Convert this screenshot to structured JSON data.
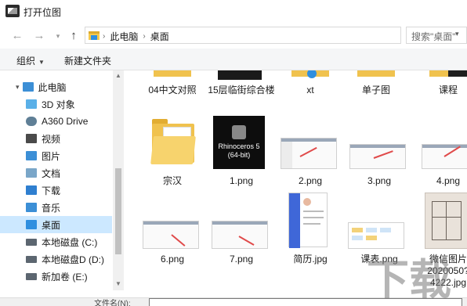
{
  "window": {
    "title": "打开位图"
  },
  "address": {
    "crumbs": [
      "此电脑",
      "桌面"
    ],
    "search_placeholder": "搜索\"桌面\""
  },
  "toolbar": {
    "organize": "组织",
    "new_folder": "新建文件夹"
  },
  "sidebar": {
    "items": [
      {
        "label": "此电脑",
        "icon": "computer-icon",
        "color": "#3c8fd6"
      },
      {
        "label": "3D 对象",
        "icon": "3d-objects-icon",
        "color": "#5ab0e8"
      },
      {
        "label": "A360 Drive",
        "icon": "cloud-drive-icon",
        "color": "#5f7f96"
      },
      {
        "label": "视频",
        "icon": "video-folder-icon",
        "color": "#4a4a4a"
      },
      {
        "label": "图片",
        "icon": "pictures-folder-icon",
        "color": "#3c8fd6"
      },
      {
        "label": "文档",
        "icon": "documents-folder-icon",
        "color": "#7aa6c8"
      },
      {
        "label": "下载",
        "icon": "downloads-folder-icon",
        "color": "#2f7fd0"
      },
      {
        "label": "音乐",
        "icon": "music-folder-icon",
        "color": "#3c8fd6"
      },
      {
        "label": "桌面",
        "icon": "desktop-folder-icon",
        "color": "#2f8fe0",
        "selected": true
      },
      {
        "label": "本地磁盘 (C:)",
        "icon": "drive-c-icon",
        "color": "#5c6670"
      },
      {
        "label": "本地磁盘D (D:)",
        "icon": "drive-d-icon",
        "color": "#5c6670"
      },
      {
        "label": "新加卷 (E:)",
        "icon": "drive-e-icon",
        "color": "#5c6670"
      }
    ]
  },
  "files": [
    {
      "name": "04中文对照",
      "kind": "folder"
    },
    {
      "name": "15层临街综合楼",
      "kind": "folder"
    },
    {
      "name": "xt",
      "kind": "folder"
    },
    {
      "name": "单子图",
      "kind": "folder"
    },
    {
      "name": "课程",
      "kind": "folder"
    },
    {
      "name": "宗汉",
      "kind": "folder"
    },
    {
      "name": "1.png",
      "kind": "image",
      "overlay_text": "Rhinoceros 5 (64-bit)"
    },
    {
      "name": "2.png",
      "kind": "image"
    },
    {
      "name": "3.png",
      "kind": "image"
    },
    {
      "name": "4.png",
      "kind": "image"
    },
    {
      "name": "6.png",
      "kind": "image"
    },
    {
      "name": "7.png",
      "kind": "image"
    },
    {
      "name": "简历.jpg",
      "kind": "image"
    },
    {
      "name": "课表.png",
      "kind": "image"
    },
    {
      "name": "微信图片_202005074222.jpg",
      "kind": "image",
      "display": "微信图片\n2020050?\n4222.jpg"
    }
  ],
  "bottom": {
    "filename_label": "文件名(N):"
  },
  "watermark": "下载",
  "colors": {
    "selected": "#cce8ff",
    "toolbar_bg": "#f5f6f7",
    "folder": "#f0c24e"
  }
}
